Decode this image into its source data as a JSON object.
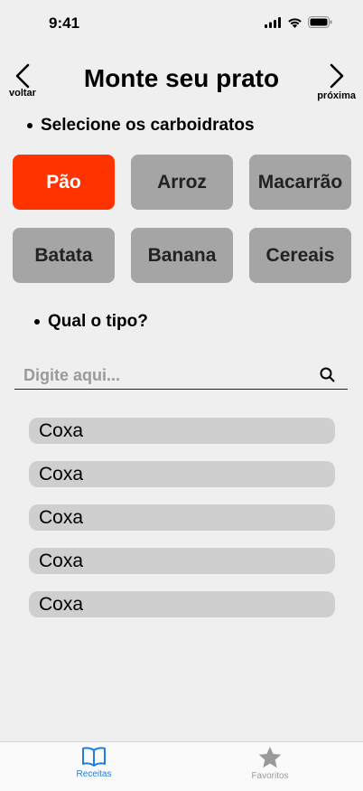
{
  "status_bar": {
    "time": "9:41"
  },
  "nav": {
    "back_label": "voltar",
    "title": "Monte seu prato",
    "next_label": "próxima"
  },
  "carbs_section": {
    "heading": "Selecione os carboidratos",
    "options": [
      {
        "label": "Pão",
        "selected": true
      },
      {
        "label": "Arroz",
        "selected": false
      },
      {
        "label": "Macarrão",
        "selected": false
      },
      {
        "label": "Batata",
        "selected": false
      },
      {
        "label": "Banana",
        "selected": false
      },
      {
        "label": "Cereais",
        "selected": false
      }
    ]
  },
  "type_section": {
    "heading": "Qual o tipo?"
  },
  "search": {
    "placeholder": "Digite aqui...",
    "value": ""
  },
  "results": [
    {
      "label": "Coxa"
    },
    {
      "label": "Coxa"
    },
    {
      "label": "Coxa"
    },
    {
      "label": "Coxa"
    },
    {
      "label": "Coxa"
    }
  ],
  "tab_bar": {
    "tabs": [
      {
        "label": "Receitas",
        "icon": "book-icon",
        "active": true
      },
      {
        "label": "Favoritos",
        "icon": "star-icon",
        "active": false
      }
    ]
  },
  "colors": {
    "selected": "#ff3300",
    "active_tab": "#1a7fe8",
    "inactive_tab": "#9a9a9a"
  }
}
